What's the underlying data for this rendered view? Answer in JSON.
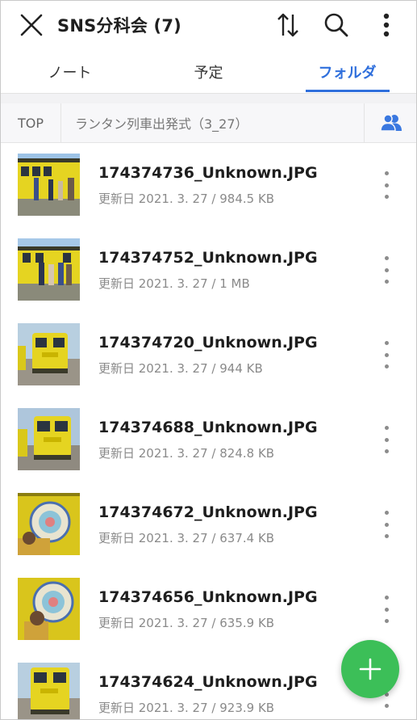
{
  "header": {
    "title": "SNS分科会 (7)",
    "close_icon": "close-icon",
    "sort_icon": "sort-icon",
    "search_icon": "search-icon",
    "more_icon": "more-vertical-icon"
  },
  "tabs": [
    {
      "label": "ノート",
      "active": false
    },
    {
      "label": "予定",
      "active": false
    },
    {
      "label": "フォルダ",
      "active": true
    }
  ],
  "breadcrumb": {
    "root": "TOP",
    "folder": "ランタン列車出発式（3_27）",
    "share_icon": "members-icon"
  },
  "files": [
    {
      "name": "174374736_Unknown.JPG",
      "meta": "更新日 2021. 3. 27 / 984.5 KB"
    },
    {
      "name": "174374752_Unknown.JPG",
      "meta": "更新日 2021. 3. 27 / 1 MB"
    },
    {
      "name": "174374720_Unknown.JPG",
      "meta": "更新日 2021. 3. 27 / 944 KB"
    },
    {
      "name": "174374688_Unknown.JPG",
      "meta": "更新日 2021. 3. 27 / 824.8 KB"
    },
    {
      "name": "174374672_Unknown.JPG",
      "meta": "更新日 2021. 3. 27 / 637.4 KB"
    },
    {
      "name": "174374656_Unknown.JPG",
      "meta": "更新日 2021. 3. 27 / 635.9 KB"
    },
    {
      "name": "174374624_Unknown.JPG",
      "meta": "更新日 2021. 3. 27 / 923.9 KB"
    }
  ],
  "fab": {
    "icon": "plus-icon"
  },
  "colors": {
    "accent": "#2f6fdc",
    "fab": "#3cbf58",
    "train_yellow": "#e5d421"
  }
}
